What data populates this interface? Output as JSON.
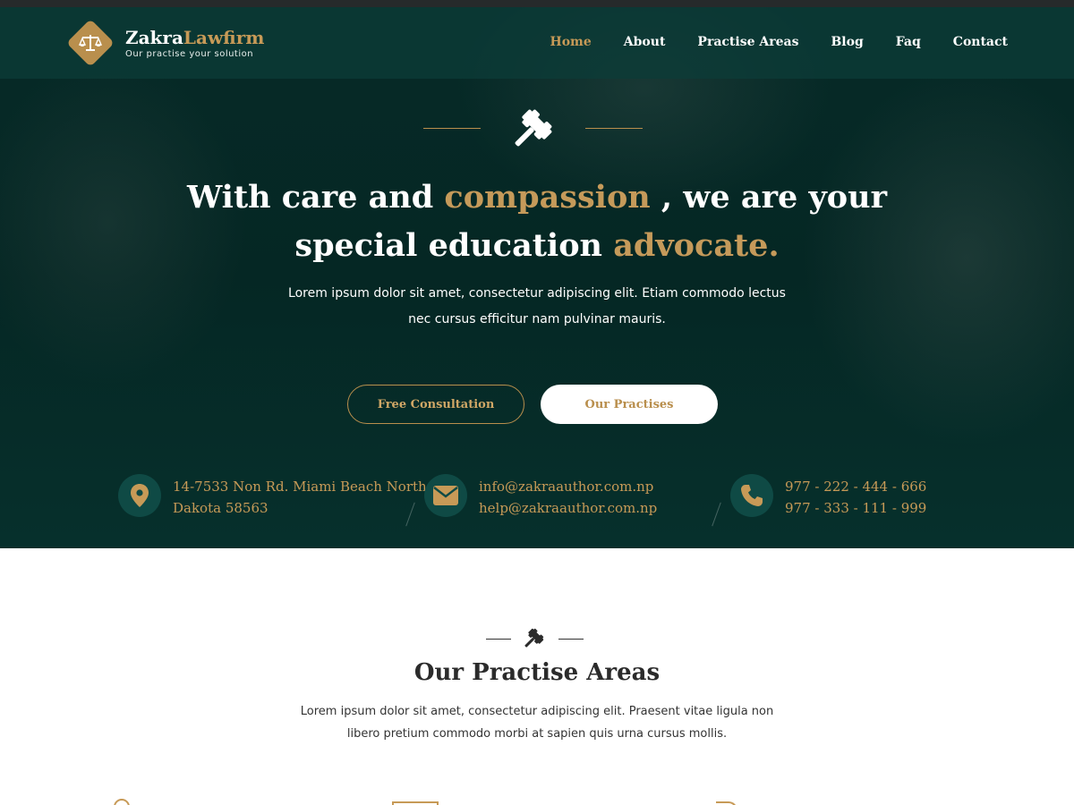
{
  "brand": {
    "name_part1": "Zakra",
    "name_part2": "Lawfirm",
    "tagline": "Our practise your solution",
    "accent_color": "#c79a57",
    "dark_color": "#052724",
    "icon": "scales-icon"
  },
  "nav": {
    "items": [
      {
        "label": "Home",
        "active": true
      },
      {
        "label": "About",
        "active": false
      },
      {
        "label": "Practise Areas",
        "active": false
      },
      {
        "label": "Blog",
        "active": false
      },
      {
        "label": "Faq",
        "active": false
      },
      {
        "label": "Contact",
        "active": false
      }
    ]
  },
  "hero": {
    "icon": "gavel-icon",
    "headline": {
      "part1": "With care and ",
      "highlight1": "compassion",
      "part2": " , we are your special education ",
      "highlight2": "advocate."
    },
    "description": "Lorem ipsum dolor sit amet, consectetur adipiscing elit. Etiam commodo lectus nec cursus efficitur nam pulvinar mauris.",
    "buttons": {
      "consultation": "Free Consultation",
      "practises": "Our Practises"
    }
  },
  "contact": {
    "address": {
      "icon": "location-pin-icon",
      "line1": "14-7533 Non Rd. Miami Beach North",
      "line2": "Dakota 58563"
    },
    "email": {
      "icon": "envelope-icon",
      "line1": "info@zakraauthor.com.np",
      "line2": "help@zakraauthor.com.np"
    },
    "phone": {
      "icon": "phone-icon",
      "line1": "977 - 222 - 444 - 666",
      "line2": "977 - 333 - 111 - 999"
    }
  },
  "practise_section": {
    "icon": "gavel-icon",
    "title": "Our Practise Areas",
    "description": "Lorem ipsum dolor sit amet, consectetur adipiscing elit. Praesent vitae ligula non libero pretium commodo morbi at sapien quis urna cursus mollis."
  }
}
